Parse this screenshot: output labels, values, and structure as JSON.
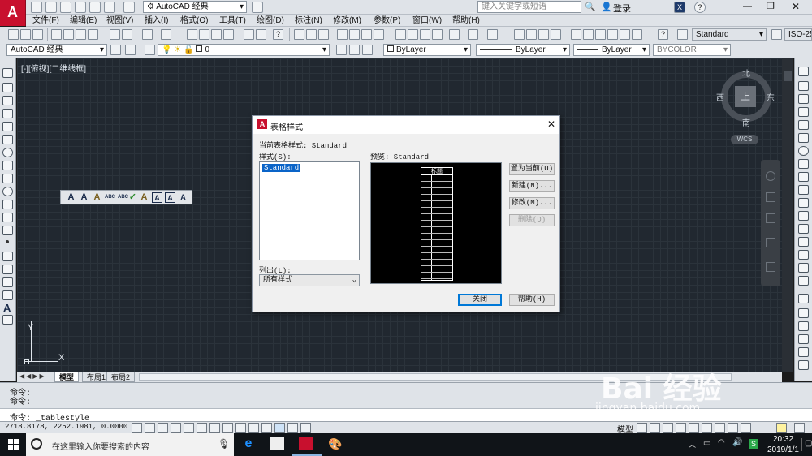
{
  "title_bar": {
    "workspace": "AutoCAD 经典",
    "search_placeholder": "键入关键字或短语",
    "login": "登录",
    "help_icon": "?"
  },
  "menu": [
    "文件(F)",
    "编辑(E)",
    "视图(V)",
    "插入(I)",
    "格式(O)",
    "工具(T)",
    "绘图(D)",
    "标注(N)",
    "修改(M)",
    "参数(P)",
    "窗口(W)",
    "帮助(H)"
  ],
  "toolbar": {
    "text_style": "Standard",
    "dim_style": "ISO-25",
    "workspace": "AutoCAD 经典",
    "layer": "0",
    "color": "ByLayer",
    "linetype": "ByLayer",
    "lineweight": "ByLayer",
    "plotstyle": "BYCOLOR"
  },
  "viewport": {
    "label": "[-][俯视][二维线框]",
    "viewcube": {
      "north": "北",
      "south": "南",
      "east": "东",
      "west": "西",
      "top": "上",
      "wcs": "WCS"
    },
    "ucs_y": "Y",
    "ucs_x": "X"
  },
  "text_toolbar": [
    "A",
    "A",
    "A",
    "ABC",
    "ABC",
    "✓",
    "A",
    "A",
    "A",
    "A"
  ],
  "layout_tabs": [
    "模型",
    "布局1",
    "布局2"
  ],
  "command": {
    "line1": "命令:",
    "line2": "命令:",
    "prompt": "命令: _tablestyle"
  },
  "status": {
    "coords": "2718.8178, 2252.1981, 0.0000",
    "model": "模型"
  },
  "dialog": {
    "title": "表格样式",
    "current_label": "当前表格样式: Standard",
    "styles_label": "样式(S):",
    "styles": [
      "Standard"
    ],
    "preview_label": "预览: Standard",
    "preview_header": "标题",
    "list_label": "列出(L):",
    "list_value": "所有样式",
    "buttons": {
      "set_current": "置为当前(U)",
      "new": "新建(N)...",
      "modify": "修改(M)...",
      "delete": "删除(D)",
      "close": "关闭",
      "help": "帮助(H)"
    }
  },
  "taskbar": {
    "search": "在这里输入你要搜索的内容",
    "time": "20:32",
    "date": "2019/1/1"
  },
  "watermark": {
    "text": "Bai 经验",
    "url": "jingyan.baidu.com"
  }
}
